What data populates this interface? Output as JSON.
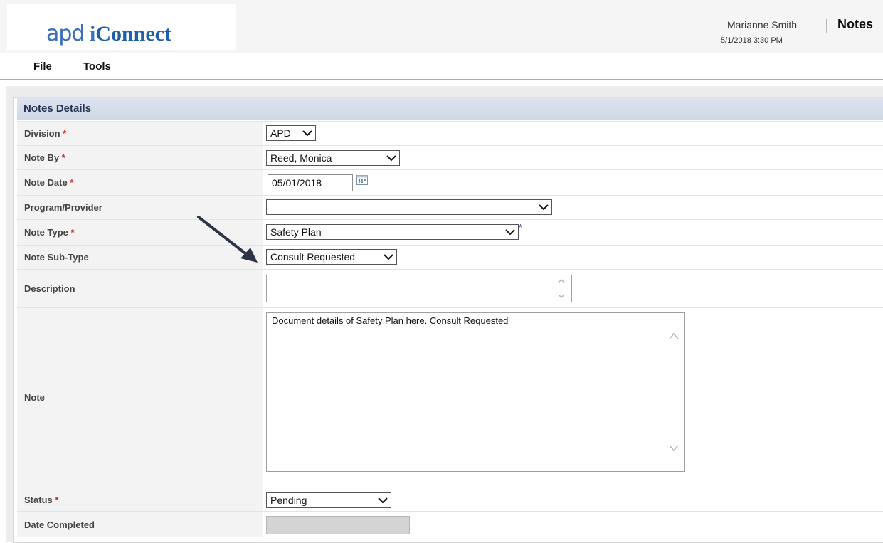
{
  "header": {
    "logo_apd": "apd",
    "logo_i": "i",
    "logo_connect": "Connect",
    "user_name": "Marianne Smith",
    "user_datetime": "5/1/2018 3:30 PM",
    "page_title": "Notes"
  },
  "menu": {
    "file": "File",
    "tools": "Tools"
  },
  "section": {
    "title": "Notes Details"
  },
  "fields": {
    "division": {
      "label": "Division",
      "required": "*",
      "value": "APD"
    },
    "note_by": {
      "label": "Note By",
      "required": "*",
      "value": "Reed, Monica"
    },
    "note_date": {
      "label": "Note Date",
      "required": "*",
      "value": "05/01/2018"
    },
    "program_provider": {
      "label": "Program/Provider",
      "value": ""
    },
    "note_type": {
      "label": "Note Type",
      "required": "*",
      "value": "Safety Plan",
      "marker": "*"
    },
    "note_subtype": {
      "label": "Note Sub-Type",
      "value": "Consult Requested"
    },
    "description": {
      "label": "Description",
      "value": ""
    },
    "note": {
      "label": "Note",
      "value": "Document details of Safety Plan here. Consult Requested"
    },
    "status": {
      "label": "Status",
      "required": "*",
      "value": "Pending"
    },
    "date_completed": {
      "label": "Date Completed",
      "value": ""
    }
  },
  "colors": {
    "menu_underline": "#e8a33d",
    "section_header": "#d4dbe9",
    "required_mark": "#d02020",
    "logo_blue": "#3d6fb6"
  },
  "icons": {
    "dropdown": "chevron-down-icon",
    "calendar": "calendar-icon",
    "pointer": "arrow-annotation-icon"
  }
}
